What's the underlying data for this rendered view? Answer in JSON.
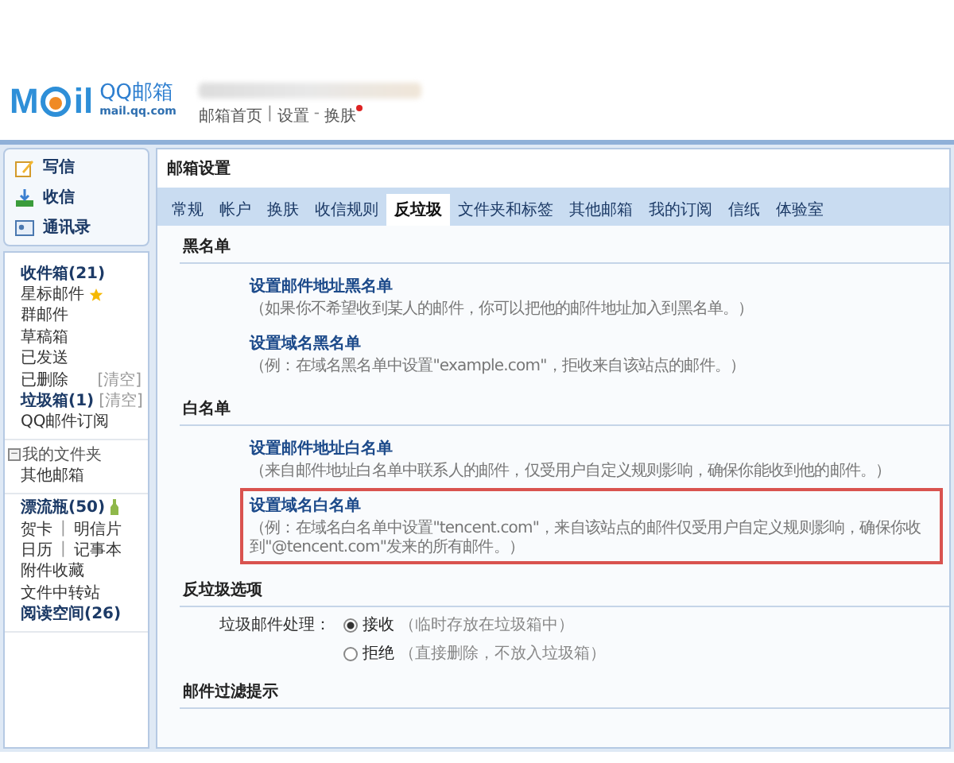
{
  "header": {
    "logo": {
      "start": "M",
      "end": "il",
      "name": "QQ邮箱",
      "domain": "mail.qq.com"
    },
    "links": [
      {
        "label": "邮箱首页",
        "new": false
      },
      {
        "separator": "|",
        "label": "设置",
        "new": false
      },
      {
        "separator": "-",
        "label": "换肤",
        "new": true
      }
    ]
  },
  "sidebar": {
    "actions": [
      {
        "label": "写信",
        "kind": "compose"
      },
      {
        "label": "收信",
        "kind": "receive"
      },
      {
        "label": "通讯录",
        "kind": "contacts"
      }
    ],
    "groups": [
      {
        "items": [
          {
            "kind": "plain",
            "label": "收件箱(21)",
            "bold": true
          },
          {
            "kind": "starred",
            "label": "星标邮件",
            "bold": false
          },
          {
            "kind": "plain",
            "label": "群邮件",
            "bold": false
          },
          {
            "kind": "plain",
            "label": "草稿箱",
            "bold": false
          },
          {
            "kind": "plain",
            "label": "已发送",
            "bold": false
          },
          {
            "kind": "plain",
            "label": "已删除",
            "bold": false,
            "action": "[清空]"
          },
          {
            "kind": "plain",
            "label": "垃圾箱(1)",
            "bold": true,
            "action": "[清空]"
          },
          {
            "kind": "plain",
            "label": "QQ邮件订阅",
            "bold": false
          }
        ]
      },
      {
        "header": {
          "toggle": "−",
          "label": "我的文件夹",
          "expanded": true
        },
        "items": [
          {
            "kind": "plain",
            "label": "其他邮箱",
            "bold": false
          }
        ]
      },
      {
        "items": [
          {
            "kind": "bottle",
            "label": "漂流瓶(50)",
            "bold": true
          },
          {
            "kind": "pair",
            "label": "贺卡",
            "separator": "|",
            "label2": "明信片",
            "bold": false
          },
          {
            "kind": "pair",
            "label": "日历",
            "separator": "|",
            "label2": "记事本",
            "bold": false
          },
          {
            "kind": "plain",
            "label": "附件收藏",
            "bold": false
          },
          {
            "kind": "plain",
            "label": "文件中转站",
            "bold": false
          },
          {
            "kind": "plain",
            "label": "阅读空间(26)",
            "bold": true
          }
        ]
      }
    ]
  },
  "main": {
    "title": "邮箱设置",
    "tabs": [
      {
        "label": "常规",
        "selected": false
      },
      {
        "label": "帐户",
        "selected": false
      },
      {
        "label": "换肤",
        "selected": false
      },
      {
        "label": "收信规则",
        "selected": false
      },
      {
        "label": "反垃圾",
        "selected": true
      },
      {
        "label": "文件夹和标签",
        "selected": false
      },
      {
        "label": "其他邮箱",
        "selected": false
      },
      {
        "label": "我的订阅",
        "selected": false
      },
      {
        "label": "信纸",
        "selected": false
      },
      {
        "label": "体验室",
        "selected": false
      }
    ],
    "sections": [
      {
        "kind": "links",
        "heading": "黑名单",
        "items": [
          {
            "title": "设置邮件地址黑名单",
            "desc": "（如果你不希望收到某人的邮件，你可以把他的邮件地址加入到黑名单。）",
            "highlighted": false
          },
          {
            "title": "设置域名黑名单",
            "desc": "（例：在域名黑名单中设置\"example.com\"，拒收来自该站点的邮件。）",
            "highlighted": false
          }
        ]
      },
      {
        "kind": "links",
        "heading": "白名单",
        "items": [
          {
            "title": "设置邮件地址白名单",
            "desc": "（来自邮件地址白名单中联系人的邮件，仅受用户自定义规则影响，确保你能收到他的邮件。）",
            "highlighted": false
          },
          {
            "title": "设置域名白名单",
            "desc": "（例：在域名白名单中设置\"tencent.com\"，来自该站点的邮件仅受用户自定义规则影响，确保你收到\"@tencent.com\"发来的所有邮件。）",
            "highlighted": true
          }
        ]
      },
      {
        "kind": "radio",
        "heading": "反垃圾选项",
        "label": "垃圾邮件处理：",
        "options": [
          {
            "label": "接收",
            "hint": "（临时存放在垃圾箱中）",
            "selected": true
          },
          {
            "label": "拒绝",
            "hint": "（直接删除，不放入垃圾箱）",
            "selected": false
          }
        ]
      },
      {
        "kind": "heading",
        "heading": "邮件过滤提示"
      }
    ]
  }
}
